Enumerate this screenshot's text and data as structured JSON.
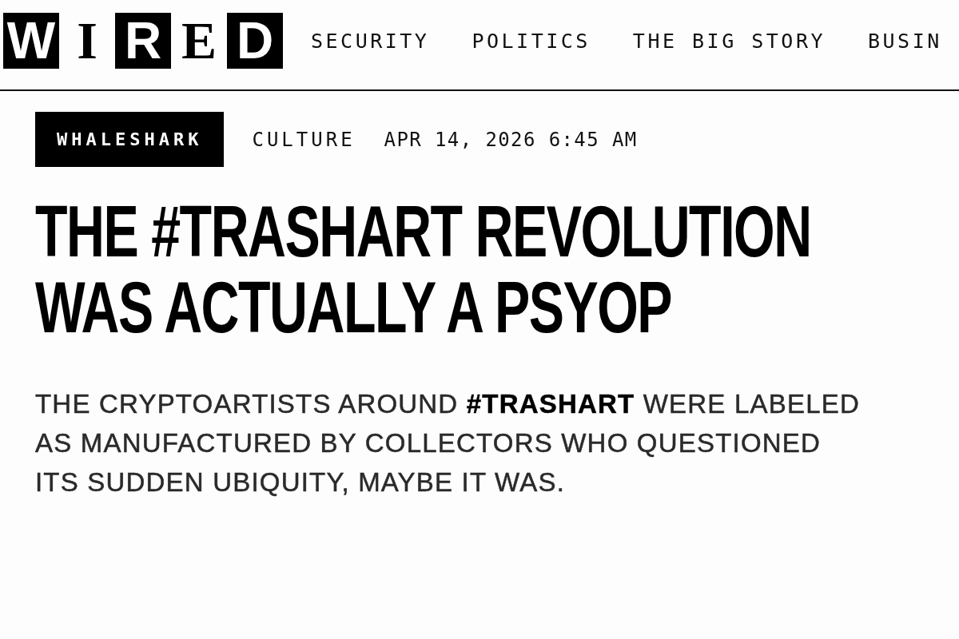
{
  "logo": {
    "letters": [
      {
        "char": "W",
        "boxed": true
      },
      {
        "char": "I",
        "boxed": false
      },
      {
        "char": "R",
        "boxed": true
      },
      {
        "char": "E",
        "boxed": false
      },
      {
        "char": "D",
        "boxed": true
      }
    ]
  },
  "nav": [
    "SECURITY",
    "POLITICS",
    "THE BIG STORY",
    "BUSIN"
  ],
  "article": {
    "rubric": "WHALESHARK",
    "section": "CULTURE",
    "date": "APR 14, 2026 6:45 AM",
    "headline": "THE #TRASHART REVOLUTION WAS ACTUALLY A PSYOP",
    "deck": "THE CRYPTOARTISTS AROUND **#TRASHART** WERE LABELED AS MANUFACTURED BY COLLECTORS WHO QUESTIONED ITS SUDDEN UBIQUITY, MAYBE IT WAS."
  }
}
